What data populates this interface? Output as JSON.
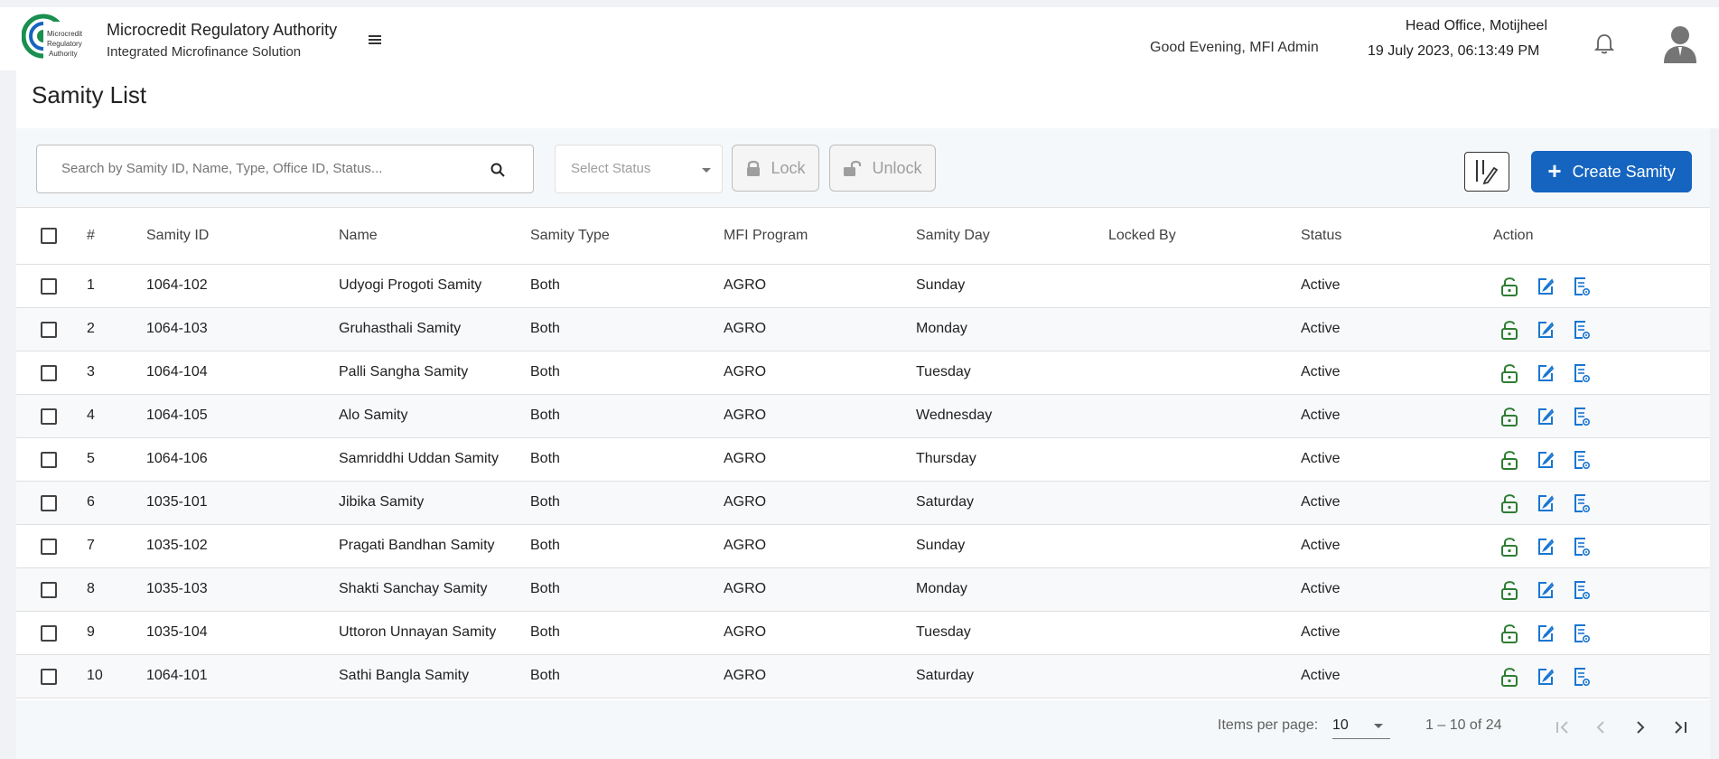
{
  "header": {
    "logo_text": "Microcredit Regulatory Authority",
    "org_name": "Microcredit Regulatory Authority",
    "subtitle": "Integrated Microfinance Solution",
    "greeting": "Good Evening, MFI Admin",
    "office": "Head Office, Motijheel",
    "datetime": "19 July 2023, 06:13:49 PM",
    "icons": [
      "menu-icon",
      "bell-icon",
      "user-avatar-icon"
    ]
  },
  "page": {
    "title": "Samity List"
  },
  "toolbar": {
    "search_placeholder": "Search by Samity ID, Name, Type, Office ID, Status...",
    "status_placeholder": "Select Status",
    "lock_label": "Lock",
    "unlock_label": "Unlock",
    "create_label": "Create Samity"
  },
  "table": {
    "headers": [
      "#",
      "Samity ID",
      "Name",
      "Samity Type",
      "MFI Program",
      "Samity Day",
      "Locked By",
      "Status",
      "Action"
    ],
    "rows": [
      [
        "1",
        "1064-102",
        "Udyogi Progoti Samity",
        "Both",
        "AGRO",
        "Sunday",
        "",
        "Active"
      ],
      [
        "2",
        "1064-103",
        "Gruhasthali Samity",
        "Both",
        "AGRO",
        "Monday",
        "",
        "Active"
      ],
      [
        "3",
        "1064-104",
        "Palli Sangha Samity",
        "Both",
        "AGRO",
        "Tuesday",
        "",
        "Active"
      ],
      [
        "4",
        "1064-105",
        "Alo Samity",
        "Both",
        "AGRO",
        "Wednesday",
        "",
        "Active"
      ],
      [
        "5",
        "1064-106",
        "Samriddhi Uddan Samity",
        "Both",
        "AGRO",
        "Thursday",
        "",
        "Active"
      ],
      [
        "6",
        "1035-101",
        "Jibika Samity",
        "Both",
        "AGRO",
        "Saturday",
        "",
        "Active"
      ],
      [
        "7",
        "1035-102",
        "Pragati Bandhan Samity",
        "Both",
        "AGRO",
        "Sunday",
        "",
        "Active"
      ],
      [
        "8",
        "1035-103",
        "Shakti Sanchay Samity",
        "Both",
        "AGRO",
        "Monday",
        "",
        "Active"
      ],
      [
        "9",
        "1035-104",
        "Uttoron Unnayan Samity",
        "Both",
        "AGRO",
        "Tuesday",
        "",
        "Active"
      ],
      [
        "10",
        "1064-101",
        "Sathi Bangla Samity",
        "Both",
        "AGRO",
        "Saturday",
        "",
        "Active"
      ]
    ],
    "row_action_icons": [
      "unlock-icon",
      "edit-icon",
      "view-details-icon"
    ]
  },
  "pagination": {
    "items_per_page_label": "Items per page:",
    "items_per_page": "10",
    "range": "1 – 10 of 24"
  },
  "colors": {
    "primary": "#1565c0",
    "unlock_green": "#2e7d32",
    "action_blue": "#1976d2"
  }
}
